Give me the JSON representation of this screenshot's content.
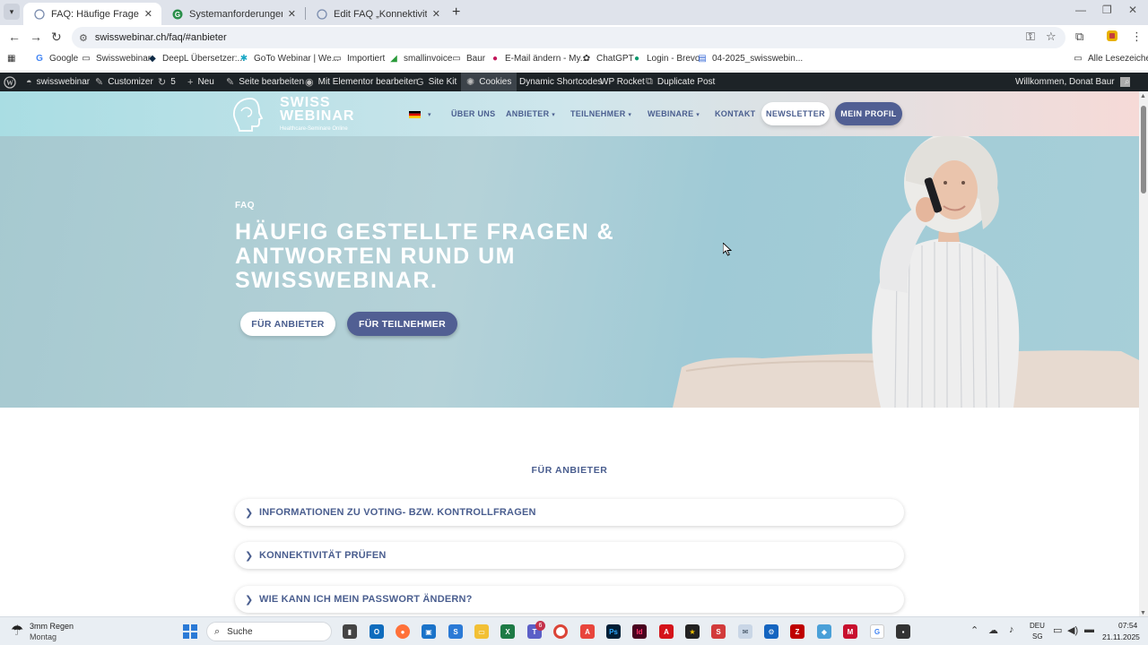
{
  "browser": {
    "tabs": [
      {
        "title": "FAQ: Häufige Fragen & Antworten",
        "favicon": "globe-icon",
        "active": true
      },
      {
        "title": "Systemanforderungen - GoTo Webinar",
        "favicon": "goto-icon",
        "active": false
      },
      {
        "title": "Edit FAQ „Konnektivität prüfen“",
        "favicon": "globe-icon",
        "active": false
      }
    ],
    "url": "swisswebinar.ch/faq/#anbieter",
    "bookmarks": [
      {
        "label": "Google",
        "icon": "google-icon"
      },
      {
        "label": "Swisswebinar",
        "icon": "folder-icon"
      },
      {
        "label": "DeepL Übersetzer:...",
        "icon": "deepl-icon"
      },
      {
        "label": "GoTo Webinar | We...",
        "icon": "goto-icon"
      },
      {
        "label": "Importiert",
        "icon": "folder-icon"
      },
      {
        "label": "smallinvoice",
        "icon": "smallinvoice-icon"
      },
      {
        "label": "Baur",
        "icon": "folder-icon"
      },
      {
        "label": "E-Mail ändern - My...",
        "icon": "mail-icon"
      },
      {
        "label": "ChatGPT",
        "icon": "chatgpt-icon"
      },
      {
        "label": "Login - Brevo",
        "icon": "brevo-icon"
      },
      {
        "label": "04-2025_swisswebin...",
        "icon": "doc-icon"
      }
    ],
    "all_bookmarks": "Alle Lesezeichen"
  },
  "wp_admin_bar": {
    "site": "swisswebinar",
    "customizer": "Customizer",
    "updates": "5",
    "new": "Neu",
    "edit_page": "Seite bearbeiten",
    "elementor": "Mit Elementor bearbeiten",
    "site_kit": "Site Kit",
    "cookies": "Cookies",
    "shortcodes": "Dynamic Shortcodes",
    "rocket": "WP Rocket",
    "duplicate": "Duplicate Post",
    "welcome": "Willkommen, Donat Baur"
  },
  "site": {
    "logo_line1": "SWISS",
    "logo_line2": "WEBINAR",
    "logo_tagline": "Healthcare-Seminare Online",
    "nav": [
      "ÜBER UNS",
      "ANBIETER",
      "TEILNEHMER",
      "WEBINARE",
      "KONTAKT"
    ],
    "newsletter": "NEWSLETTER",
    "profile": "MEIN PROFIL"
  },
  "hero": {
    "eyebrow": "FAQ",
    "title": "HÄUFIG GESTELLTE FRAGEN & ANTWORTEN RUND UM SWISSWEBINAR.",
    "btn_providers": "FÜR ANBIETER",
    "btn_participants": "FÜR TEILNEHMER"
  },
  "faq": {
    "heading": "FÜR ANBIETER",
    "items": [
      "INFORMATIONEN ZU VOTING- BZW. KONTROLLFRAGEN",
      "KONNEKTIVITÄT PRÜFEN",
      "WIE KANN ICH MEIN PASSWORT ÄNDERN?"
    ]
  },
  "taskbar": {
    "weather_line1": "3mm Regen",
    "weather_line2": "Montag",
    "search": "Suche",
    "badge": "6",
    "lang1": "DEU",
    "lang2": "SG",
    "time": "07:54",
    "date": "21.11.2025"
  },
  "colors": {
    "brand_blue": "#4a5e8f",
    "brand_button": "#515f93",
    "wp_bar": "#1d2327"
  }
}
